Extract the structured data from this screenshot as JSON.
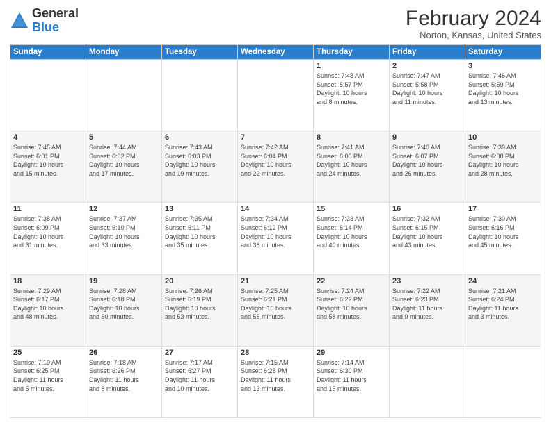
{
  "header": {
    "logo_general": "General",
    "logo_blue": "Blue",
    "month_title": "February 2024",
    "location": "Norton, Kansas, United States"
  },
  "days_of_week": [
    "Sunday",
    "Monday",
    "Tuesday",
    "Wednesday",
    "Thursday",
    "Friday",
    "Saturday"
  ],
  "weeks": [
    [
      {
        "day": "",
        "info": ""
      },
      {
        "day": "",
        "info": ""
      },
      {
        "day": "",
        "info": ""
      },
      {
        "day": "",
        "info": ""
      },
      {
        "day": "1",
        "info": "Sunrise: 7:48 AM\nSunset: 5:57 PM\nDaylight: 10 hours\nand 8 minutes."
      },
      {
        "day": "2",
        "info": "Sunrise: 7:47 AM\nSunset: 5:58 PM\nDaylight: 10 hours\nand 11 minutes."
      },
      {
        "day": "3",
        "info": "Sunrise: 7:46 AM\nSunset: 5:59 PM\nDaylight: 10 hours\nand 13 minutes."
      }
    ],
    [
      {
        "day": "4",
        "info": "Sunrise: 7:45 AM\nSunset: 6:01 PM\nDaylight: 10 hours\nand 15 minutes."
      },
      {
        "day": "5",
        "info": "Sunrise: 7:44 AM\nSunset: 6:02 PM\nDaylight: 10 hours\nand 17 minutes."
      },
      {
        "day": "6",
        "info": "Sunrise: 7:43 AM\nSunset: 6:03 PM\nDaylight: 10 hours\nand 19 minutes."
      },
      {
        "day": "7",
        "info": "Sunrise: 7:42 AM\nSunset: 6:04 PM\nDaylight: 10 hours\nand 22 minutes."
      },
      {
        "day": "8",
        "info": "Sunrise: 7:41 AM\nSunset: 6:05 PM\nDaylight: 10 hours\nand 24 minutes."
      },
      {
        "day": "9",
        "info": "Sunrise: 7:40 AM\nSunset: 6:07 PM\nDaylight: 10 hours\nand 26 minutes."
      },
      {
        "day": "10",
        "info": "Sunrise: 7:39 AM\nSunset: 6:08 PM\nDaylight: 10 hours\nand 28 minutes."
      }
    ],
    [
      {
        "day": "11",
        "info": "Sunrise: 7:38 AM\nSunset: 6:09 PM\nDaylight: 10 hours\nand 31 minutes."
      },
      {
        "day": "12",
        "info": "Sunrise: 7:37 AM\nSunset: 6:10 PM\nDaylight: 10 hours\nand 33 minutes."
      },
      {
        "day": "13",
        "info": "Sunrise: 7:35 AM\nSunset: 6:11 PM\nDaylight: 10 hours\nand 35 minutes."
      },
      {
        "day": "14",
        "info": "Sunrise: 7:34 AM\nSunset: 6:12 PM\nDaylight: 10 hours\nand 38 minutes."
      },
      {
        "day": "15",
        "info": "Sunrise: 7:33 AM\nSunset: 6:14 PM\nDaylight: 10 hours\nand 40 minutes."
      },
      {
        "day": "16",
        "info": "Sunrise: 7:32 AM\nSunset: 6:15 PM\nDaylight: 10 hours\nand 43 minutes."
      },
      {
        "day": "17",
        "info": "Sunrise: 7:30 AM\nSunset: 6:16 PM\nDaylight: 10 hours\nand 45 minutes."
      }
    ],
    [
      {
        "day": "18",
        "info": "Sunrise: 7:29 AM\nSunset: 6:17 PM\nDaylight: 10 hours\nand 48 minutes."
      },
      {
        "day": "19",
        "info": "Sunrise: 7:28 AM\nSunset: 6:18 PM\nDaylight: 10 hours\nand 50 minutes."
      },
      {
        "day": "20",
        "info": "Sunrise: 7:26 AM\nSunset: 6:19 PM\nDaylight: 10 hours\nand 53 minutes."
      },
      {
        "day": "21",
        "info": "Sunrise: 7:25 AM\nSunset: 6:21 PM\nDaylight: 10 hours\nand 55 minutes."
      },
      {
        "day": "22",
        "info": "Sunrise: 7:24 AM\nSunset: 6:22 PM\nDaylight: 10 hours\nand 58 minutes."
      },
      {
        "day": "23",
        "info": "Sunrise: 7:22 AM\nSunset: 6:23 PM\nDaylight: 11 hours\nand 0 minutes."
      },
      {
        "day": "24",
        "info": "Sunrise: 7:21 AM\nSunset: 6:24 PM\nDaylight: 11 hours\nand 3 minutes."
      }
    ],
    [
      {
        "day": "25",
        "info": "Sunrise: 7:19 AM\nSunset: 6:25 PM\nDaylight: 11 hours\nand 5 minutes."
      },
      {
        "day": "26",
        "info": "Sunrise: 7:18 AM\nSunset: 6:26 PM\nDaylight: 11 hours\nand 8 minutes."
      },
      {
        "day": "27",
        "info": "Sunrise: 7:17 AM\nSunset: 6:27 PM\nDaylight: 11 hours\nand 10 minutes."
      },
      {
        "day": "28",
        "info": "Sunrise: 7:15 AM\nSunset: 6:28 PM\nDaylight: 11 hours\nand 13 minutes."
      },
      {
        "day": "29",
        "info": "Sunrise: 7:14 AM\nSunset: 6:30 PM\nDaylight: 11 hours\nand 15 minutes."
      },
      {
        "day": "",
        "info": ""
      },
      {
        "day": "",
        "info": ""
      }
    ]
  ]
}
